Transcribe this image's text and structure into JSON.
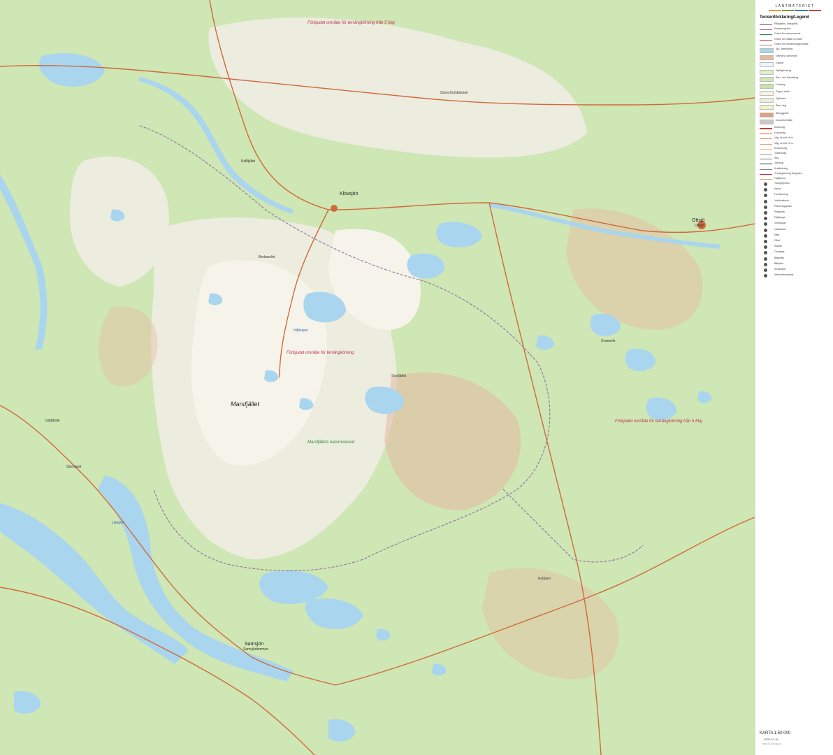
{
  "colors": {
    "forest": "#cfe6b5",
    "open_land": "#f6f4ea",
    "mountain": "#ececdf",
    "water": "#a9d5ee",
    "mire": "#e8b8a0",
    "road": "#d06a3a",
    "boundary": "#8a6a9a"
  },
  "map": {
    "labels": [
      {
        "id": "fjallnas-a",
        "text": "Förbjudet område för terrängkörning från 5 Maj",
        "cls": "red"
      },
      {
        "id": "fjallnas-b",
        "text": "Förbjudet område för terrängkörning",
        "cls": "red"
      },
      {
        "id": "fjallnas-c",
        "text": "Förbjudet område för terrängkörning från 5 Maj",
        "cls": "red"
      },
      {
        "id": "marsfjallet",
        "text": "Marsfjället",
        "cls": "lg"
      },
      {
        "id": "reserve",
        "text": "Marsfjällets naturreservat",
        "cls": "grn"
      },
      {
        "id": "klovsjo",
        "text": "Klövsjön",
        "cls": "md"
      },
      {
        "id": "ottsjo",
        "text": "Ottsjö",
        "cls": "md"
      },
      {
        "id": "ottsjo-sub",
        "text": "Ottsjö",
        "cls": "sm"
      },
      {
        "id": "stora-dombacken",
        "text": "Stora Dombäcken",
        "cls": "sm"
      },
      {
        "id": "borkaselet",
        "text": "Borkaselet",
        "cls": "sm"
      },
      {
        "id": "kallfjallet",
        "text": "Kallfjället",
        "cls": "sm"
      },
      {
        "id": "samsjon",
        "text": "Samsjön",
        "cls": "md"
      },
      {
        "id": "samsjon-sub",
        "text": "Samsjödammen",
        "cls": "sm"
      },
      {
        "id": "stornaset",
        "text": "Stornäset",
        "cls": "sm"
      },
      {
        "id": "gaddede",
        "text": "Gäddede",
        "cls": "sm"
      },
      {
        "id": "hallesjon",
        "text": "Hållesjön",
        "cls": "blu"
      },
      {
        "id": "svansele",
        "text": "Svansele",
        "cls": "sm"
      },
      {
        "id": "storfjallet",
        "text": "Storfjället",
        "cls": "sm"
      },
      {
        "id": "kolasen",
        "text": "Kolåsen",
        "cls": "sm"
      },
      {
        "id": "lillasjon",
        "text": "Lillasjön",
        "cls": "blu"
      }
    ]
  },
  "legend": {
    "brand": "LANTMÄTERIET",
    "title": "Teckenförklaring/Legend",
    "items": [
      "Riksgräns, länsgräns",
      "Kommungräns",
      "Gräns för naturreservat",
      "Gräns för militärt område",
      "Gräns för fornlämningsområde",
      "Sjö, vattendrag",
      "Våtmark, sankmark",
      "Glaciär",
      "Fjällbjörkskog",
      "Barr- och blandskog",
      "Lövskog",
      "Öppen mark",
      "Fjällmark",
      "Åker, äng",
      "Bebyggelse",
      "Industriområde",
      "Motorväg",
      "Huvudväg",
      "Väg, bredd >5 m",
      "Väg, bredd <5 m",
      "Enskild väg",
      "Traktorväg",
      "Stig",
      "Järnväg",
      "Kraftledning",
      "Terrängkörning förbjuden",
      "Höjdkurva",
      "Triangelpunkt",
      "Kyrka",
      "Fornlämning",
      "Vindkraftverk",
      "Parkeringsplats",
      "Rastplats",
      "Fjällstuga",
      "Vindskydd",
      "Utsiktstorn",
      "Kåta",
      "Gård",
      "Skidlift",
      "Camping",
      "Badplats",
      "Båtplats",
      "Sevärdhet",
      "Informationstavla"
    ],
    "scale": "KARTA 1:50 000",
    "date": "2020-10-16",
    "copyright": "Källa © Lantmäteriet"
  }
}
